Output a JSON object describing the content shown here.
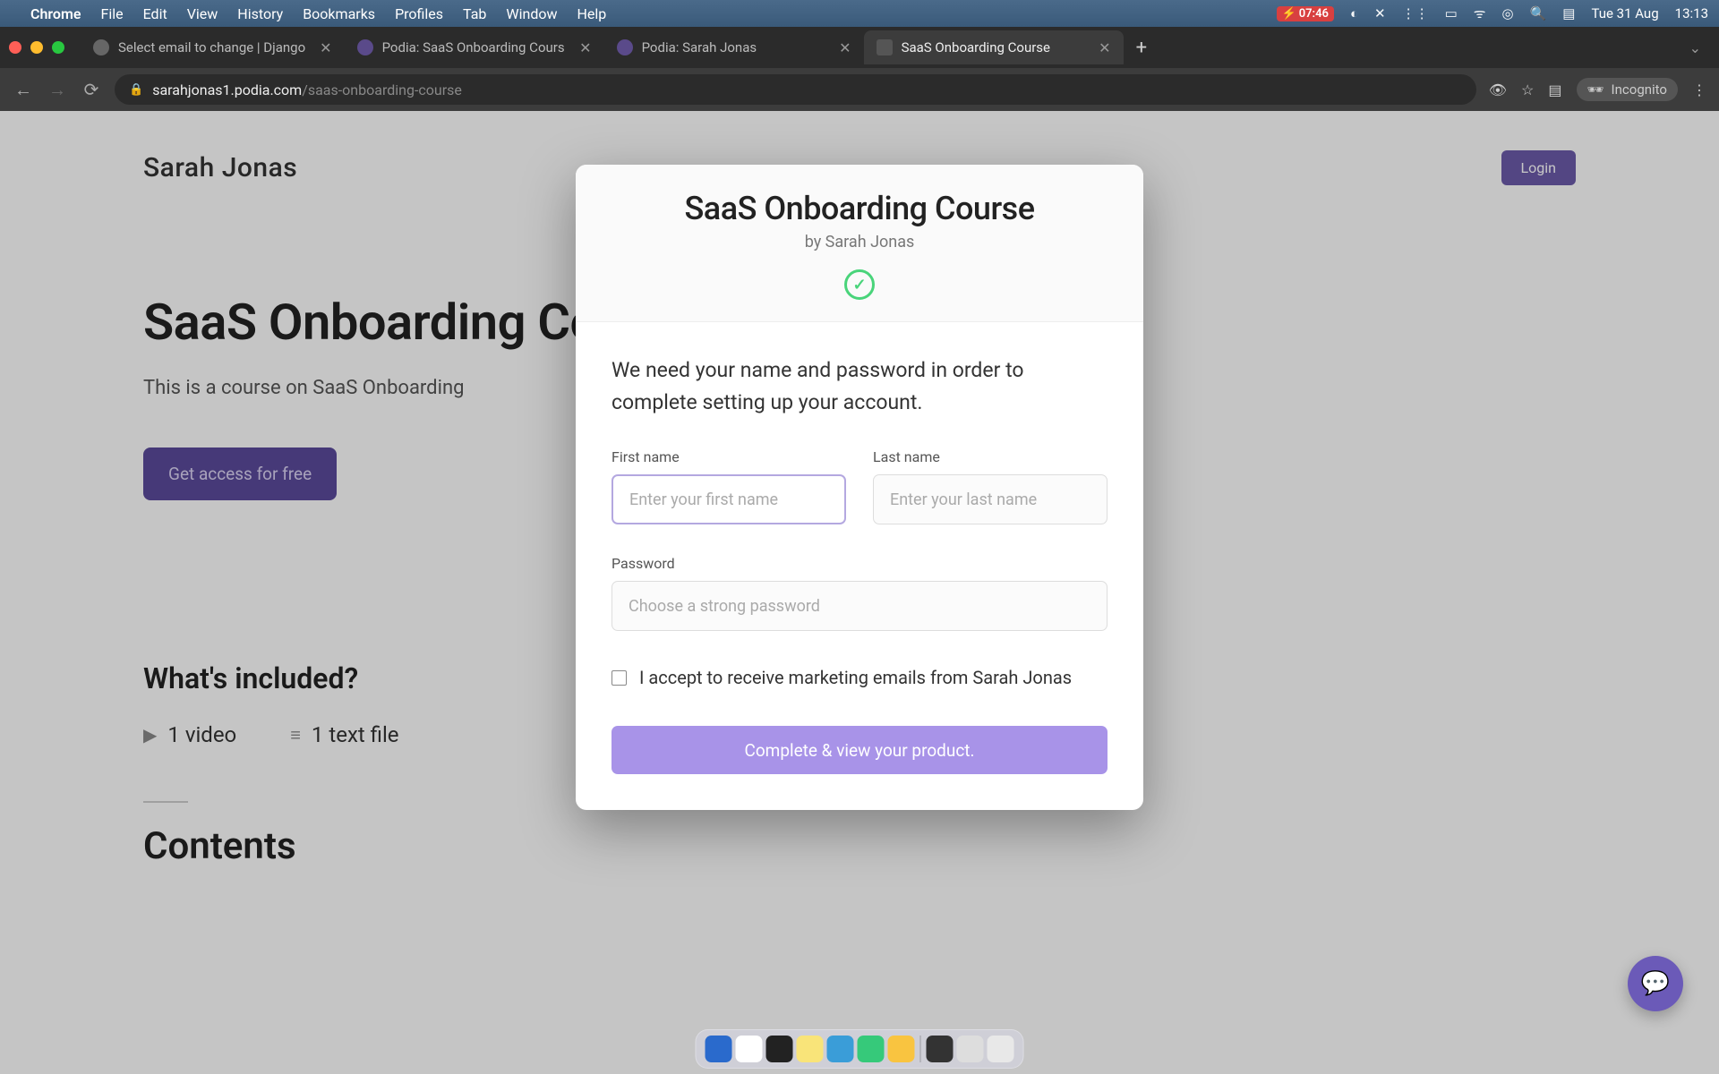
{
  "menubar": {
    "app": "Chrome",
    "items": [
      "File",
      "Edit",
      "View",
      "History",
      "Bookmarks",
      "Profiles",
      "Tab",
      "Window",
      "Help"
    ],
    "battery": "07:46",
    "date": "Tue 31 Aug",
    "time": "13:13"
  },
  "tabs": [
    {
      "title": "Select email to change | Django",
      "active": false
    },
    {
      "title": "Podia: SaaS Onboarding Cours",
      "active": false
    },
    {
      "title": "Podia: Sarah Jonas",
      "active": false
    },
    {
      "title": "SaaS Onboarding Course",
      "active": true
    }
  ],
  "address": {
    "domain": "sarahjonas1.podia.com",
    "path": "/saas-onboarding-course",
    "incognito": "Incognito"
  },
  "page": {
    "site_name": "Sarah Jonas",
    "login": "Login",
    "hero_title": "SaaS Onboarding Course",
    "hero_desc": "This is a course on SaaS Onboarding",
    "cta": "Get access for free",
    "included_title": "What's included?",
    "included_items": [
      {
        "icon": "▶",
        "label": "1 video"
      },
      {
        "icon": "≡",
        "label": "1 text file"
      }
    ],
    "contents_title": "Contents"
  },
  "modal": {
    "title": "SaaS Onboarding Course",
    "byline": "by Sarah Jonas",
    "intro": "We need your name and password in order to complete setting up your account.",
    "first_name_label": "First name",
    "first_name_placeholder": "Enter your first name",
    "last_name_label": "Last name",
    "last_name_placeholder": "Enter your last name",
    "password_label": "Password",
    "password_placeholder": "Choose a strong password",
    "marketing_label": "I accept to receive marketing emails from Sarah Jonas",
    "submit": "Complete & view your product."
  }
}
